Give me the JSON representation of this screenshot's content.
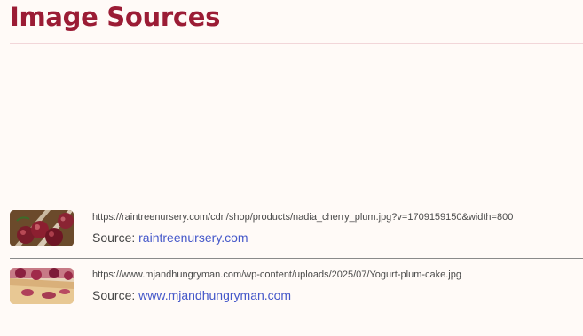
{
  "page": {
    "title": "Image Sources"
  },
  "sources": [
    {
      "image_subject": "cherry-plums",
      "url": "https://raintreenursery.com/cdn/shop/products/nadia_cherry_plum.jpg?v=1709159150&width=800",
      "source_label": "Source:",
      "source_name": "raintreenursery.com"
    },
    {
      "image_subject": "plum-cake",
      "url": "https://www.mjandhungryman.com/wp-content/uploads/2025/07/Yogurt-plum-cake.jpg",
      "source_label": "Source:",
      "source_name": "www.mjandhungryman.com"
    }
  ],
  "colors": {
    "title": "#9b1c35",
    "link": "#4457c9",
    "background": "#fffaf7",
    "rule": "#f2d6d9"
  }
}
